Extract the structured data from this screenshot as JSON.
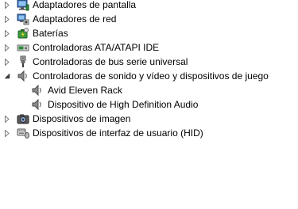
{
  "device_tree": {
    "items": [
      {
        "label": "Adaptadores de pantalla",
        "icon": "display-adapter-icon",
        "state": "collapsed",
        "level": 0
      },
      {
        "label": "Adaptadores de red",
        "icon": "network-adapter-icon",
        "state": "collapsed",
        "level": 0
      },
      {
        "label": "Baterías",
        "icon": "battery-icon",
        "state": "collapsed",
        "level": 0
      },
      {
        "label": "Controladoras ATA/ATAPI IDE",
        "icon": "ide-controller-icon",
        "state": "collapsed",
        "level": 0
      },
      {
        "label": "Controladoras de bus serie universal",
        "icon": "usb-controller-icon",
        "state": "collapsed",
        "level": 0
      },
      {
        "label": "Controladoras de sonido y vídeo y dispositivos de juego",
        "icon": "sound-video-game-icon",
        "state": "expanded",
        "level": 0
      },
      {
        "label": "Avid Eleven Rack",
        "icon": "speaker-icon",
        "state": "leaf",
        "level": 1
      },
      {
        "label": "Dispositivo de High Definition Audio",
        "icon": "speaker-icon",
        "state": "leaf",
        "level": 1
      },
      {
        "label": "Dispositivos de imagen",
        "icon": "camera-icon",
        "state": "collapsed",
        "level": 0
      },
      {
        "label": "Dispositivos de interfaz de usuario (HID)",
        "icon": "hid-icon",
        "state": "collapsed",
        "level": 0
      }
    ]
  }
}
